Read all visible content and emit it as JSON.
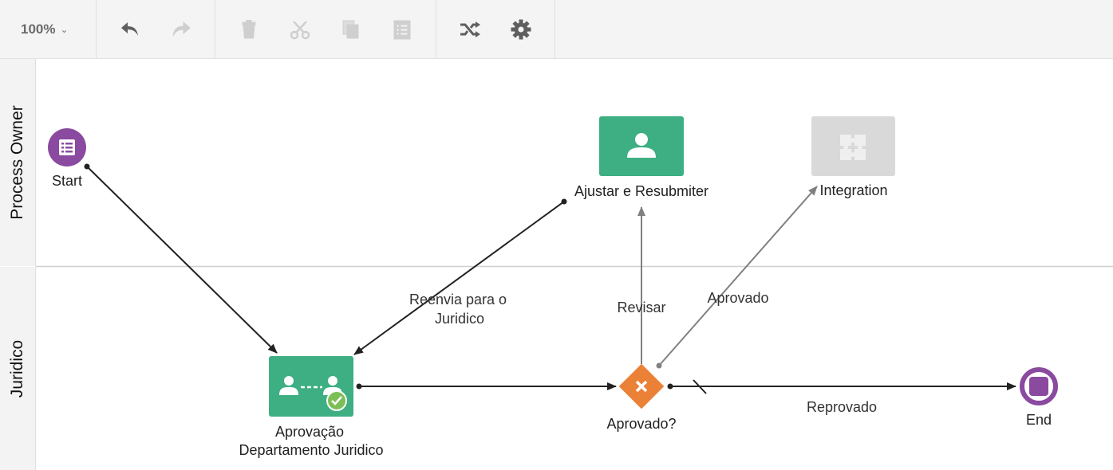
{
  "toolbar": {
    "zoom_label": "100%"
  },
  "lanes": [
    {
      "label": "Process Owner"
    },
    {
      "label": "Juridico"
    }
  ],
  "nodes": {
    "start": {
      "label": "Start",
      "color": "#8a4aa0"
    },
    "end": {
      "label": "End",
      "color": "#8a4aa0"
    },
    "ajustar": {
      "label": "Ajustar e Resubmiter",
      "color": "#3daf83"
    },
    "integration": {
      "label": "Integration",
      "color": "#d9d9d9"
    },
    "aprovacao": {
      "label_line1": "Aprovação",
      "label_line2": "Departamento Juridico",
      "color": "#3daf83"
    },
    "gateway": {
      "label": "Aprovado?",
      "color": "#ea8136"
    }
  },
  "flows": {
    "reenvia_line1": "Reenvia para o",
    "reenvia_line2": "Juridico",
    "revisar": "Revisar",
    "aprovado": "Aprovado",
    "reprovado": "Reprovado"
  },
  "colors": {
    "line_dark": "#222222",
    "line_gray": "#808080",
    "check_badge": "#7cbf57"
  }
}
